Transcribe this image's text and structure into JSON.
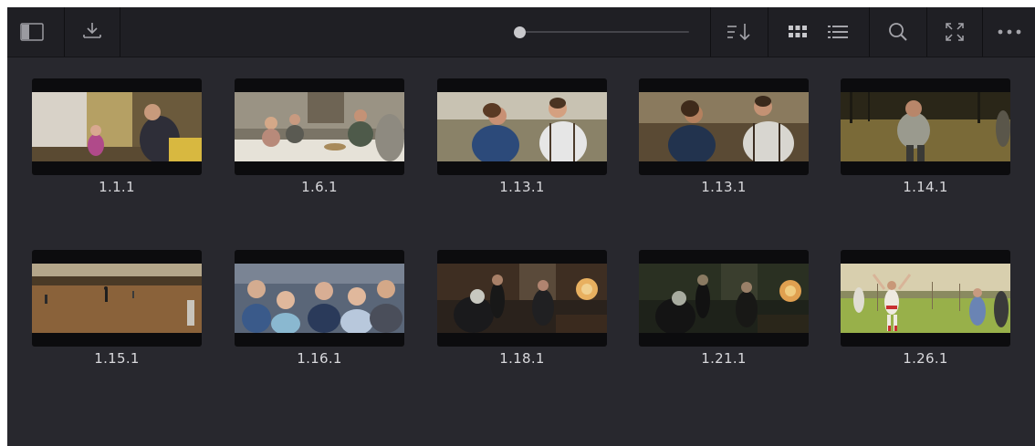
{
  "toolbar": {
    "buttons": [
      {
        "name": "sidebar-toggle-icon"
      },
      {
        "name": "import-icon"
      },
      {
        "name": "sort-icon"
      },
      {
        "name": "grid-view-icon"
      },
      {
        "name": "list-view-icon"
      },
      {
        "name": "search-icon"
      },
      {
        "name": "fullscreen-icon"
      },
      {
        "name": "more-options-icon"
      }
    ],
    "zoom_slider_level": 0.0
  },
  "clips": [
    {
      "label": "1.1.1"
    },
    {
      "label": "1.6.1"
    },
    {
      "label": "1.13.1"
    },
    {
      "label": "1.13.1"
    },
    {
      "label": "1.14.1"
    },
    {
      "label": "1.15.1"
    },
    {
      "label": "1.16.1"
    },
    {
      "label": "1.18.1"
    },
    {
      "label": "1.21.1"
    },
    {
      "label": "1.26.1"
    }
  ]
}
